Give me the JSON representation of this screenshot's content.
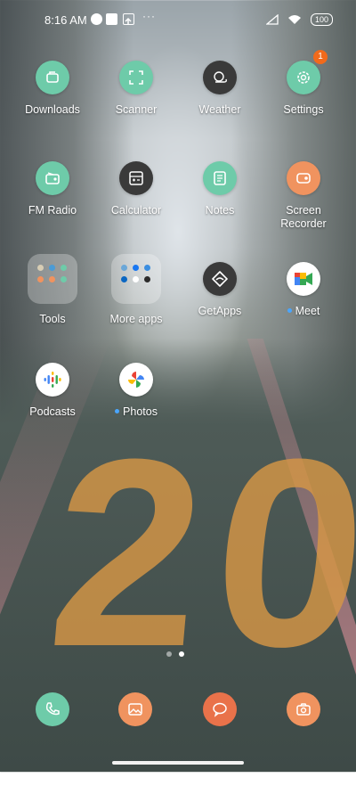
{
  "status_bar": {
    "time": "8:16 AM",
    "battery": "100",
    "more": "···"
  },
  "apps": [
    {
      "label": "Downloads",
      "icon": "downloads-icon",
      "color": "#6ecba9"
    },
    {
      "label": "Scanner",
      "icon": "scanner-icon",
      "color": "#6ecba9"
    },
    {
      "label": "Weather",
      "icon": "weather-icon",
      "color": "#3a3a3a"
    },
    {
      "label": "Settings",
      "icon": "settings-icon",
      "color": "#6ecba9",
      "badge": "1"
    },
    {
      "label": "FM Radio",
      "icon": "radio-icon",
      "color": "#6ecba9"
    },
    {
      "label": "Calculator",
      "icon": "calculator-icon",
      "color": "#3a3a3a"
    },
    {
      "label": "Notes",
      "icon": "notes-icon",
      "color": "#6ecba9"
    },
    {
      "label": "Screen\nRecorder",
      "icon": "screen-recorder-icon",
      "color": "#f0935f"
    },
    {
      "label": "Tools",
      "icon": "tools-folder-icon"
    },
    {
      "label": "More apps",
      "icon": "more-apps-folder-icon"
    },
    {
      "label": "GetApps",
      "icon": "getapps-icon",
      "color": "#3a3a3a"
    },
    {
      "label": "Meet",
      "icon": "google-meet-icon",
      "color": "#ffffff",
      "new": true
    },
    {
      "label": "Podcasts",
      "icon": "google-podcasts-icon",
      "color": "#ffffff"
    },
    {
      "label": "Photos",
      "icon": "google-photos-icon",
      "color": "#ffffff",
      "new": true
    }
  ],
  "dock": [
    {
      "icon": "phone-icon",
      "color": "#6ecba9"
    },
    {
      "icon": "gallery-icon",
      "color": "#f0935f"
    },
    {
      "icon": "messages-icon",
      "color": "#e9724a"
    },
    {
      "icon": "camera-icon",
      "color": "#f0935f"
    }
  ],
  "pages": {
    "count": 2,
    "active": 2
  }
}
